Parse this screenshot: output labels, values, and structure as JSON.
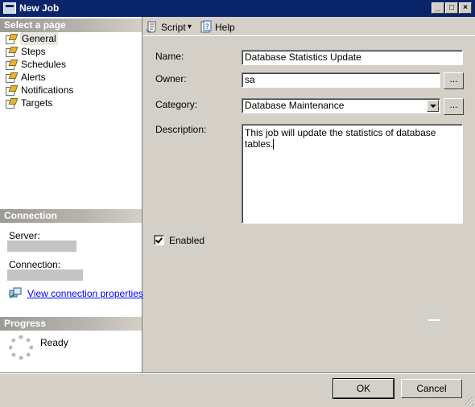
{
  "window": {
    "title": "New Job",
    "controls": [
      "_",
      "□",
      "×"
    ]
  },
  "left_pane": {
    "select_page_header": "Select a page",
    "pages": [
      {
        "label": "General",
        "selected": true
      },
      {
        "label": "Steps",
        "selected": false
      },
      {
        "label": "Schedules",
        "selected": false
      },
      {
        "label": "Alerts",
        "selected": false
      },
      {
        "label": "Notifications",
        "selected": false
      },
      {
        "label": "Targets",
        "selected": false
      }
    ],
    "connection_header": "Connection",
    "server_label": "Server:",
    "connection_label": "Connection:",
    "view_connection_link": "View connection properties",
    "progress_header": "Progress",
    "progress_status": "Ready"
  },
  "toolbar": {
    "script_label": "Script",
    "script_dropdown_glyph": "▾",
    "help_label": "Help"
  },
  "form": {
    "name_label": "Name:",
    "name_value": "Database Statistics Update",
    "owner_label": "Owner:",
    "owner_value": "sa",
    "category_label": "Category:",
    "category_value": "Database Maintenance",
    "description_label": "Description:",
    "description_value": "This job will update the statistics of database tables.",
    "browse_label": "...",
    "enabled_label": "Enabled",
    "enabled_checked": true
  },
  "buttons": {
    "ok": "OK",
    "cancel": "Cancel"
  },
  "colors": {
    "titlebar": "#0a246a",
    "face": "#d4d0c8",
    "link": "#0000ff"
  }
}
